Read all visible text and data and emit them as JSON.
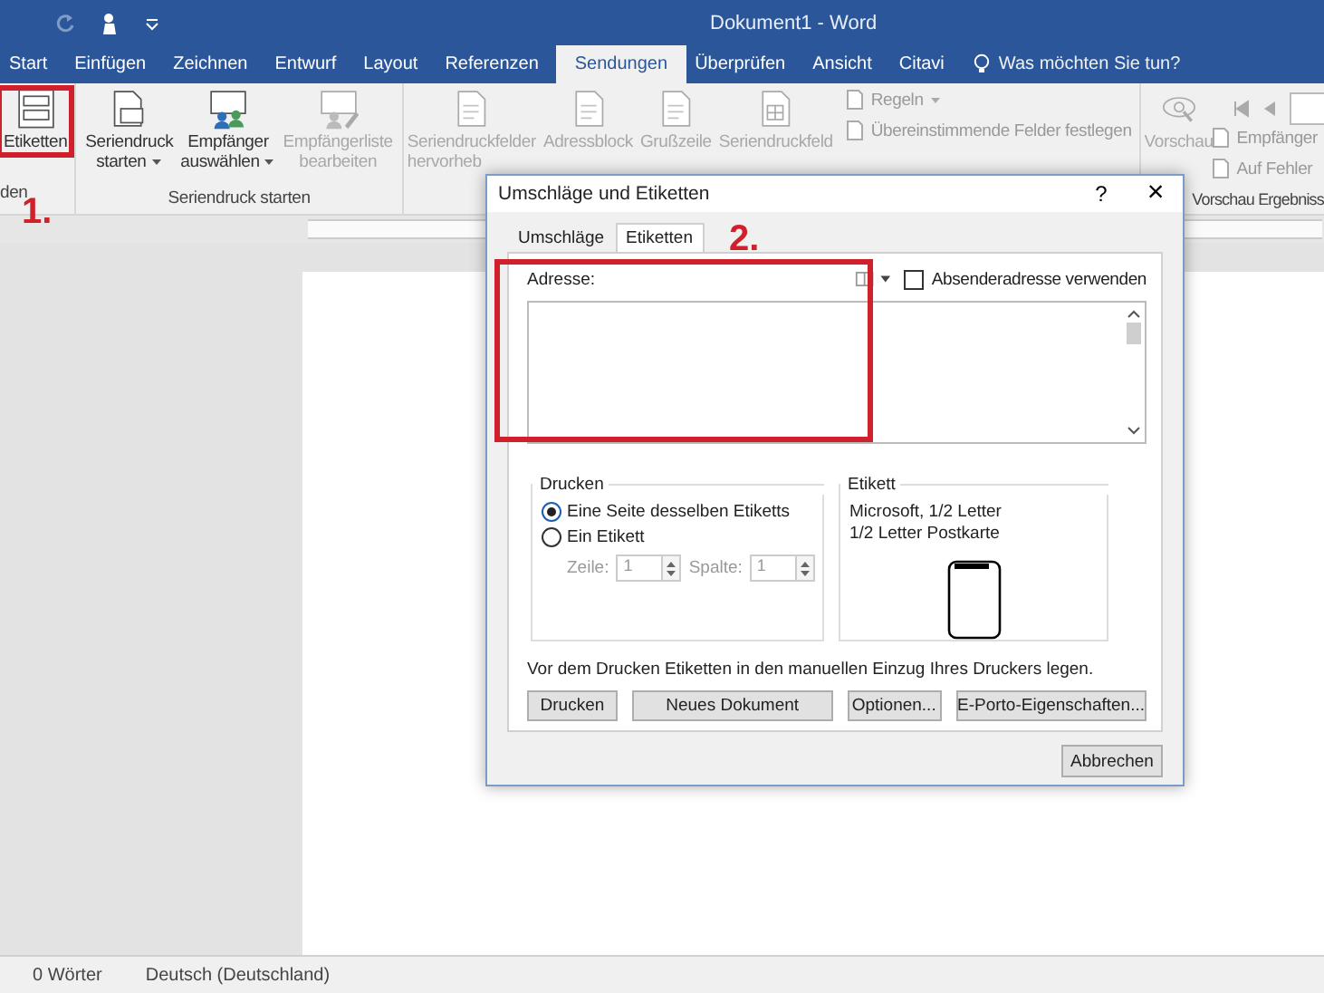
{
  "window": {
    "title": "Dokument1  -  Word"
  },
  "ribbon_tabs": [
    {
      "label": "Start",
      "selected": false
    },
    {
      "label": "Einfügen",
      "selected": false
    },
    {
      "label": "Zeichnen",
      "selected": false
    },
    {
      "label": "Entwurf",
      "selected": false
    },
    {
      "label": "Layout",
      "selected": false
    },
    {
      "label": "Referenzen",
      "selected": false
    },
    {
      "label": "Sendungen",
      "selected": true
    },
    {
      "label": "Überprüfen",
      "selected": false
    },
    {
      "label": "Ansicht",
      "selected": false
    },
    {
      "label": "Citavi",
      "selected": false
    }
  ],
  "tell_me": {
    "placeholder": "Was möchten Sie tun?"
  },
  "ribbon_groups": [
    {
      "label": "den",
      "buttons": [
        {
          "kind": "labels",
          "lines": [
            "Etiketten"
          ],
          "dropdown": false,
          "disabled": false,
          "highlighted": true
        }
      ]
    },
    {
      "label": "Seriendruck starten",
      "buttons": [
        {
          "kind": "merge",
          "lines": [
            "Seriendruck",
            "starten"
          ],
          "dropdown": true,
          "disabled": false,
          "highlighted": false
        },
        {
          "kind": "recipients",
          "lines": [
            "Empfänger",
            "auswählen"
          ],
          "dropdown": true,
          "disabled": false,
          "highlighted": false
        },
        {
          "kind": "edit-list",
          "lines": [
            "Empfängerliste",
            "bearbeiten"
          ],
          "dropdown": false,
          "disabled": true,
          "highlighted": false
        }
      ]
    },
    {
      "buttons": [
        {
          "kind": "doc",
          "lines": [
            "Seriendruckfelder",
            "hervorheb"
          ],
          "dropdown": false,
          "disabled": true,
          "highlighted": false
        },
        {
          "kind": "doc",
          "lines": [
            "Adressblock"
          ],
          "dropdown": false,
          "disabled": true,
          "highlighted": false
        },
        {
          "kind": "doc",
          "lines": [
            "Grußzeile"
          ],
          "dropdown": false,
          "disabled": true,
          "highlighted": false
        },
        {
          "kind": "grid",
          "lines": [
            "Seriendruckfeld"
          ],
          "dropdown": false,
          "disabled": true,
          "highlighted": false
        }
      ],
      "small": [
        {
          "label": "Regeln",
          "dropdown": true
        },
        {
          "label": "Übereinstimmende Felder festlegen",
          "dropdown": false
        }
      ]
    },
    {
      "label": "Vorschau Ergebniss",
      "buttons": [
        {
          "kind": "preview",
          "lines": [
            "Vorschau"
          ],
          "dropdown": false,
          "disabled": true,
          "highlighted": false
        }
      ],
      "small": [
        {
          "label": "Empfänger",
          "dropdown": false
        },
        {
          "label": "Auf Fehler",
          "dropdown": false
        }
      ]
    }
  ],
  "annotations": [
    "1.",
    "2."
  ],
  "dialog": {
    "title": "Umschläge und Etiketten",
    "help": "?",
    "close": "×",
    "tabs": [
      {
        "label": "Umschläge",
        "selected": false
      },
      {
        "label": "Etiketten",
        "selected": true
      }
    ],
    "address_label": "Adresse:",
    "sender_checkbox": {
      "label": "Absenderadresse verwenden",
      "checked": false
    },
    "print_group": {
      "title": "Drucken",
      "options": [
        {
          "label": "Eine Seite desselben Etiketts",
          "selected": true
        },
        {
          "label": "Ein Etikett",
          "selected": false
        }
      ],
      "row_label": "Zeile:",
      "row_value": "1",
      "col_label": "Spalte:",
      "col_value": "1",
      "disabled": true
    },
    "label_group": {
      "title": "Etikett",
      "lines": [
        "Microsoft, 1/2 Letter",
        "1/2 Letter Postkarte"
      ]
    },
    "note": "Vor dem Drucken Etiketten in den manuellen Einzug Ihres Druckers legen.",
    "buttons": [
      "Drucken",
      "Neues Dokument",
      "Optionen...",
      "E-Porto-Eigenschaften..."
    ],
    "cancel": "Abbrechen"
  },
  "status_bar": [
    "0 Wörter",
    "Deutsch (Deutschland)"
  ]
}
